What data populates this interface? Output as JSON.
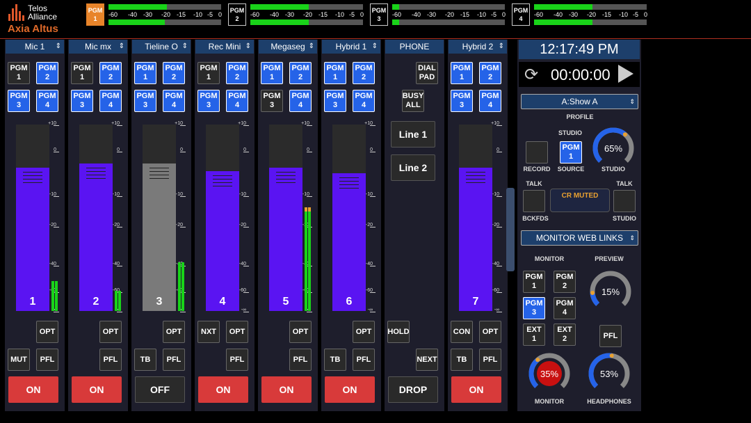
{
  "header": {
    "brand": "Telos\nAlliance",
    "product": "Axia Altus",
    "programs": [
      {
        "label": "PGM\n1",
        "selected": true,
        "meter": 0.52,
        "meter2": 0.5
      },
      {
        "label": "PGM\n2",
        "selected": false,
        "meter": 0.52,
        "meter2": 0.52
      },
      {
        "label": "PGM\n3",
        "selected": false,
        "meter": 0.06,
        "meter2": 0.06
      },
      {
        "label": "PGM\n4",
        "selected": false,
        "meter": 0.52,
        "meter2": 0.52
      }
    ],
    "scale": [
      "-60",
      "-40",
      "-30",
      "-20",
      "-15",
      "-10",
      "-5",
      "0"
    ]
  },
  "scale_labels": [
    "+10",
    "0",
    "-10",
    "-20",
    "-40",
    "-60",
    "-∞"
  ],
  "channels": [
    {
      "name": "Mic 1",
      "number": "1",
      "pgm": [
        "PGM\n1",
        "PGM\n2",
        "PGM\n3",
        "PGM\n4"
      ],
      "pgm_on": [
        false,
        true,
        true,
        true
      ],
      "level": 0.77,
      "gray": false,
      "meter": [
        0.16,
        0.16
      ],
      "buttons": [
        "OPT",
        "MUT",
        "PFL"
      ],
      "state": "ON"
    },
    {
      "name": "Mic mx",
      "number": "2",
      "pgm": [
        "PGM\n1",
        "PGM\n2",
        "PGM\n3",
        "PGM\n4"
      ],
      "pgm_on": [
        false,
        true,
        true,
        true
      ],
      "level": 0.79,
      "gray": false,
      "meter": [
        0.11,
        0.11
      ],
      "buttons": [
        "OPT",
        "PFL"
      ],
      "state": "ON"
    },
    {
      "name": "Tieline O",
      "number": "3",
      "pgm": [
        "PGM\n1",
        "PGM\n2",
        "PGM\n3",
        "PGM\n4"
      ],
      "pgm_on": [
        true,
        true,
        true,
        true
      ],
      "level": 0.79,
      "gray": true,
      "meter": [
        0.26,
        0.26
      ],
      "buttons": [
        "OPT",
        "TB",
        "PFL"
      ],
      "state": "OFF"
    },
    {
      "name": "Rec Mini",
      "number": "4",
      "pgm": [
        "PGM\n1",
        "PGM\n2",
        "PGM\n3",
        "PGM\n4"
      ],
      "pgm_on": [
        false,
        true,
        true,
        true
      ],
      "level": 0.75,
      "gray": false,
      "meter": [
        0,
        0
      ],
      "buttons": [
        "NXT",
        "OPT",
        "PFL"
      ],
      "state": "ON"
    },
    {
      "name": "Megaseg",
      "number": "5",
      "pgm": [
        "PGM\n1",
        "PGM\n2",
        "PGM\n3",
        "PGM\n4"
      ],
      "pgm_on": [
        true,
        true,
        false,
        true
      ],
      "level": 0.77,
      "gray": false,
      "meter": [
        0.55,
        0.55
      ],
      "buttons": [
        "OPT",
        "PFL"
      ],
      "state": "ON"
    },
    {
      "name": "Hybrid 1",
      "number": "6",
      "pgm": [
        "PGM\n1",
        "PGM\n2",
        "PGM\n3",
        "PGM\n4"
      ],
      "pgm_on": [
        true,
        true,
        true,
        true
      ],
      "level": 0.74,
      "gray": false,
      "meter": [
        0,
        0
      ],
      "buttons": [
        "OPT",
        "TB",
        "PFL"
      ],
      "state": "ON"
    },
    {
      "name": "Hybrid 2",
      "number": "7",
      "pgm": [
        "PGM\n1",
        "PGM\n2",
        "PGM\n3",
        "PGM\n4"
      ],
      "pgm_on": [
        true,
        true,
        true,
        true
      ],
      "level": 0.77,
      "gray": false,
      "meter": [
        0,
        0
      ],
      "buttons": [
        "CON",
        "OPT",
        "TB",
        "PFL"
      ],
      "state": "ON"
    }
  ],
  "phone": {
    "title": "PHONE",
    "dial": "DIAL\nPAD",
    "busy": "BUSY\nALL",
    "line1": "Line 1",
    "line2": "Line 2",
    "hold": "HOLD",
    "next": "NEXT",
    "drop": "DROP"
  },
  "right": {
    "clock": "12:17:49 PM",
    "timer": "00:00:00",
    "show": "A:Show A",
    "profile": "PROFILE",
    "studio_label": "STUDIO",
    "record": "RECORD",
    "source": "SOURCE",
    "source_btn": "PGM\n1",
    "studio_knob": {
      "value": "65%",
      "level": 0.65,
      "label": "STUDIO"
    },
    "talk_left": "TALK",
    "talk_right": "TALK",
    "cr_muted": "CR MUTED",
    "bckfds": "BCKFDS",
    "studio2": "STUDIO",
    "weblinks": "MONITOR WEB LINKS",
    "monitor_label": "MONITOR",
    "preview_label": "PREVIEW",
    "mon_btns": [
      "PGM\n1",
      "PGM\n2",
      "PGM\n3",
      "PGM\n4",
      "EXT\n1",
      "EXT\n2"
    ],
    "mon_on": [
      false,
      false,
      true,
      false,
      false,
      false
    ],
    "preview_knob": {
      "value": "15%",
      "level": 0.15
    },
    "pfl": "PFL",
    "monitor_knob": {
      "value": "35%",
      "level": 0.35,
      "label": "MONITOR"
    },
    "headphones_knob": {
      "value": "53%",
      "level": 0.53,
      "label": "HEADPHONES"
    }
  },
  "colors": {
    "accent": "#2563e8",
    "fader": "#5a14f2",
    "on": "#d83a3a",
    "meter": "#19d319",
    "header": "#1d3f6b"
  }
}
